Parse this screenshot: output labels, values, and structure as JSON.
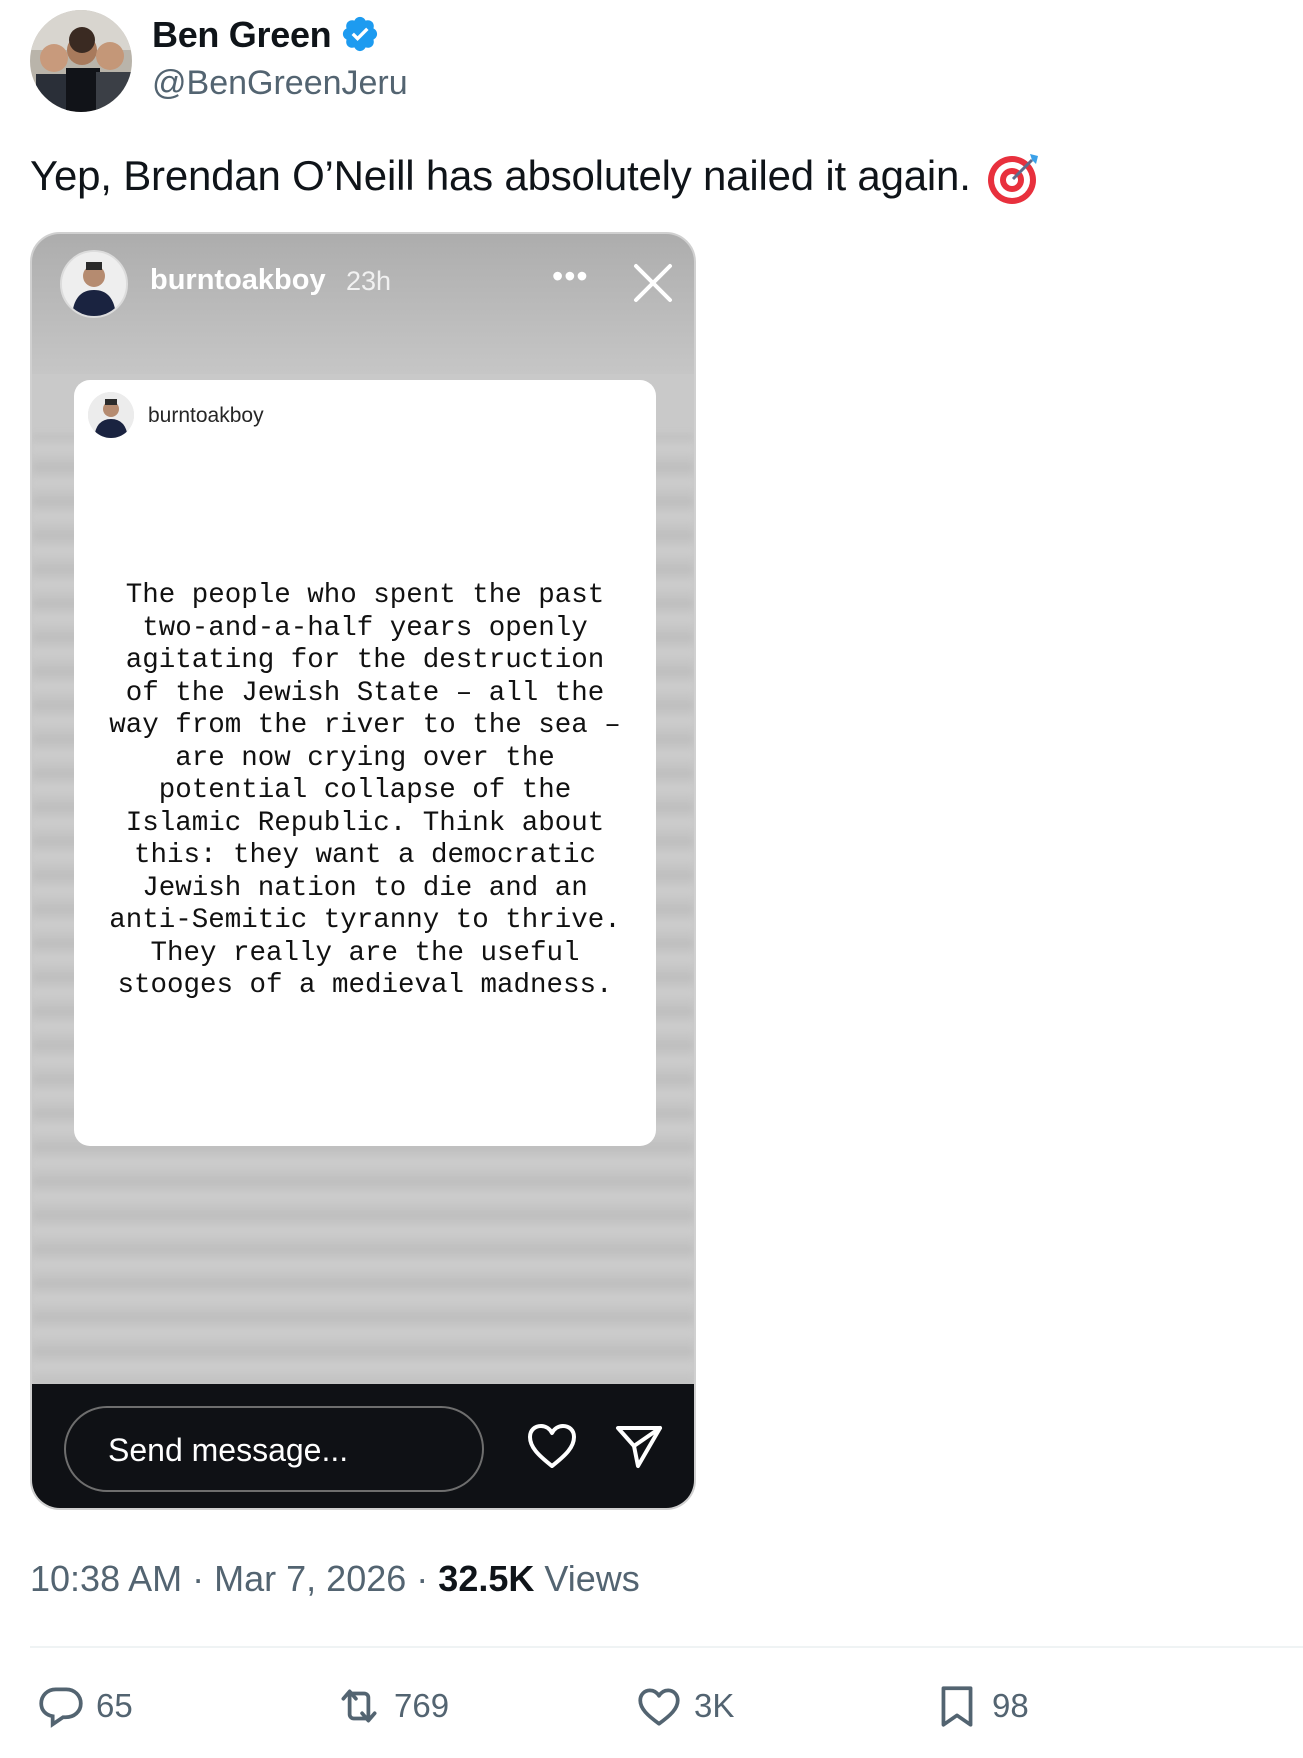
{
  "author": {
    "name": "Ben Green",
    "handle": "@BenGreenJeru",
    "verified_icon": "verified-badge-icon",
    "avatar": "group-photo-avatar"
  },
  "tweet": {
    "text": "Yep, Brendan O’Neill has absolutely nailed it again.",
    "emoji_icon": "direct-hit-target-icon"
  },
  "story": {
    "username": "burntoakboy",
    "time": "23h",
    "more_label": "•••",
    "close_icon": "close-icon",
    "card": {
      "username": "burntoakboy",
      "lines": "The people who spent the past\ntwo-and-a-half years openly\nagitating for the destruction\nof the Jewish State – all the\nway from the river to the sea –\nare now crying over the\npotential collapse of the\nIslamic Republic. Think about\nthis: they want a democratic\nJewish nation to die and an\nanti-Semitic tyranny to thrive.\nThey really are the useful\nstooges of a medieval madness."
    },
    "message_placeholder": "Send message...",
    "heart_icon": "heart-outline-icon",
    "send_icon": "paper-plane-icon"
  },
  "meta": {
    "time": "10:38 AM",
    "sep1": "·",
    "date": "Mar 7, 2026",
    "sep2": "·",
    "views_count": "32.5K",
    "views_label": "Views"
  },
  "actions": {
    "replies": "65",
    "reposts": "769",
    "likes": "3K",
    "bookmarks": "98"
  },
  "colors": {
    "verified_blue": "#1d9bf0",
    "secondary_text": "#536471",
    "primary_text": "#0f1419",
    "story_bottom_bg": "#0f1115"
  }
}
